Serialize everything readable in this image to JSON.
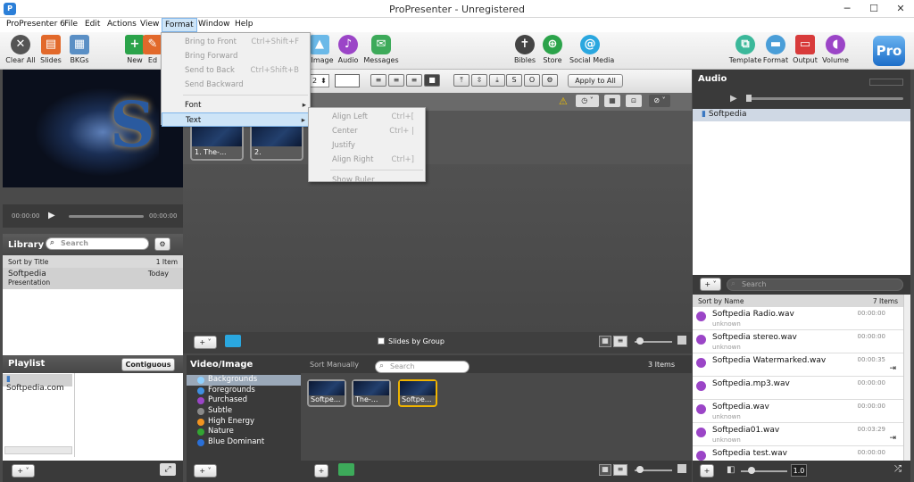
{
  "window": {
    "title": "ProPresenter - Unregistered"
  },
  "menubar": {
    "items": [
      "ProPresenter 6",
      "File",
      "Edit",
      "Actions",
      "View",
      "Format",
      "Window",
      "Help"
    ]
  },
  "toolbar": {
    "left": [
      "Clear All",
      "Slides",
      "BKGs",
      "New",
      "Ed"
    ],
    "middle": [
      "Image",
      "Audio",
      "Messages"
    ],
    "center": [
      "Bibles",
      "Store",
      "Social Media"
    ],
    "right": [
      "Template",
      "Format",
      "Output",
      "Volume"
    ]
  },
  "format_menu": {
    "items": [
      {
        "label": "Bring to Front",
        "shortcut": "Ctrl+Shift+F"
      },
      {
        "label": "Bring Forward",
        "shortcut": ""
      },
      {
        "label": "Send to Back",
        "shortcut": "Ctrl+Shift+B"
      },
      {
        "label": "Send Backward",
        "shortcut": ""
      },
      {
        "label": "Font",
        "shortcut": ""
      },
      {
        "label": "Text",
        "shortcut": ""
      }
    ]
  },
  "text_submenu": {
    "items": [
      {
        "label": "Align Left",
        "shortcut": "Ctrl+["
      },
      {
        "label": "Center",
        "shortcut": "Ctrl+ |"
      },
      {
        "label": "Justify",
        "shortcut": ""
      },
      {
        "label": "Align Right",
        "shortcut": "Ctrl+]"
      },
      {
        "label": "Show Ruler",
        "shortcut": ""
      }
    ]
  },
  "editor": {
    "apply_all": "Apply to All",
    "slides_by_group": "Slides by Group",
    "font_size": "2",
    "bold_btn": "S",
    "outline_btn": "O"
  },
  "preview": {
    "time_start": "00:00:00",
    "time_end": "00:00:00"
  },
  "library": {
    "title": "Library",
    "search_placeholder": "Search",
    "sort_label": "Sort by Title",
    "count": "1 Item",
    "items": [
      {
        "name": "Softpedia",
        "type": "Presentation",
        "date": "Today"
      }
    ]
  },
  "playlist": {
    "title": "Playlist",
    "contiguous": "Contiguous",
    "items": [
      "Softpedia.com"
    ]
  },
  "slides": [
    {
      "label": "1. The-..."
    },
    {
      "label": "2."
    }
  ],
  "media": {
    "title": "Video/Image",
    "sort_label": "Sort Manually",
    "search_placeholder": "Search",
    "count": "3 Items",
    "categories": [
      {
        "name": "Backgrounds",
        "color": "#8fd0ff"
      },
      {
        "name": "Foregrounds",
        "color": "#3f8fe0"
      },
      {
        "name": "Purchased",
        "color": "#9b45c7"
      },
      {
        "name": "Subtle",
        "color": "#8a8a8a"
      },
      {
        "name": "High Energy",
        "color": "#f29320"
      },
      {
        "name": "Nature",
        "color": "#33a532"
      },
      {
        "name": "Blue Dominant",
        "color": "#2a6fd6"
      }
    ],
    "thumbs": [
      "Softpe...",
      "The-...",
      "Softpe..."
    ]
  },
  "audio": {
    "title": "Audio",
    "current_item": "Softpedia",
    "search_placeholder": "Search",
    "sort_label": "Sort by Name",
    "count": "7 Items",
    "volume": "1.0",
    "items": [
      {
        "name": "Softpedia Radio.wav",
        "artist": "unknown",
        "time": "00:00:00"
      },
      {
        "name": "Softpedia stereo.wav",
        "artist": "unknown",
        "time": "00:00:00"
      },
      {
        "name": "Softpedia Watermarked.wav",
        "artist": "",
        "time": "00:00:35"
      },
      {
        "name": "Softpedia.mp3.wav",
        "artist": "",
        "time": "00:00:00"
      },
      {
        "name": "Softpedia.wav",
        "artist": "unknown",
        "time": "00:00:00"
      },
      {
        "name": "Softpedia01.wav",
        "artist": "unknown",
        "time": "00:03:29"
      },
      {
        "name": "Softpedia test.wav",
        "artist": "",
        "time": "00:00:00"
      }
    ]
  },
  "colors": {
    "accent": "#f0b400",
    "purple": "#9b45c7"
  }
}
